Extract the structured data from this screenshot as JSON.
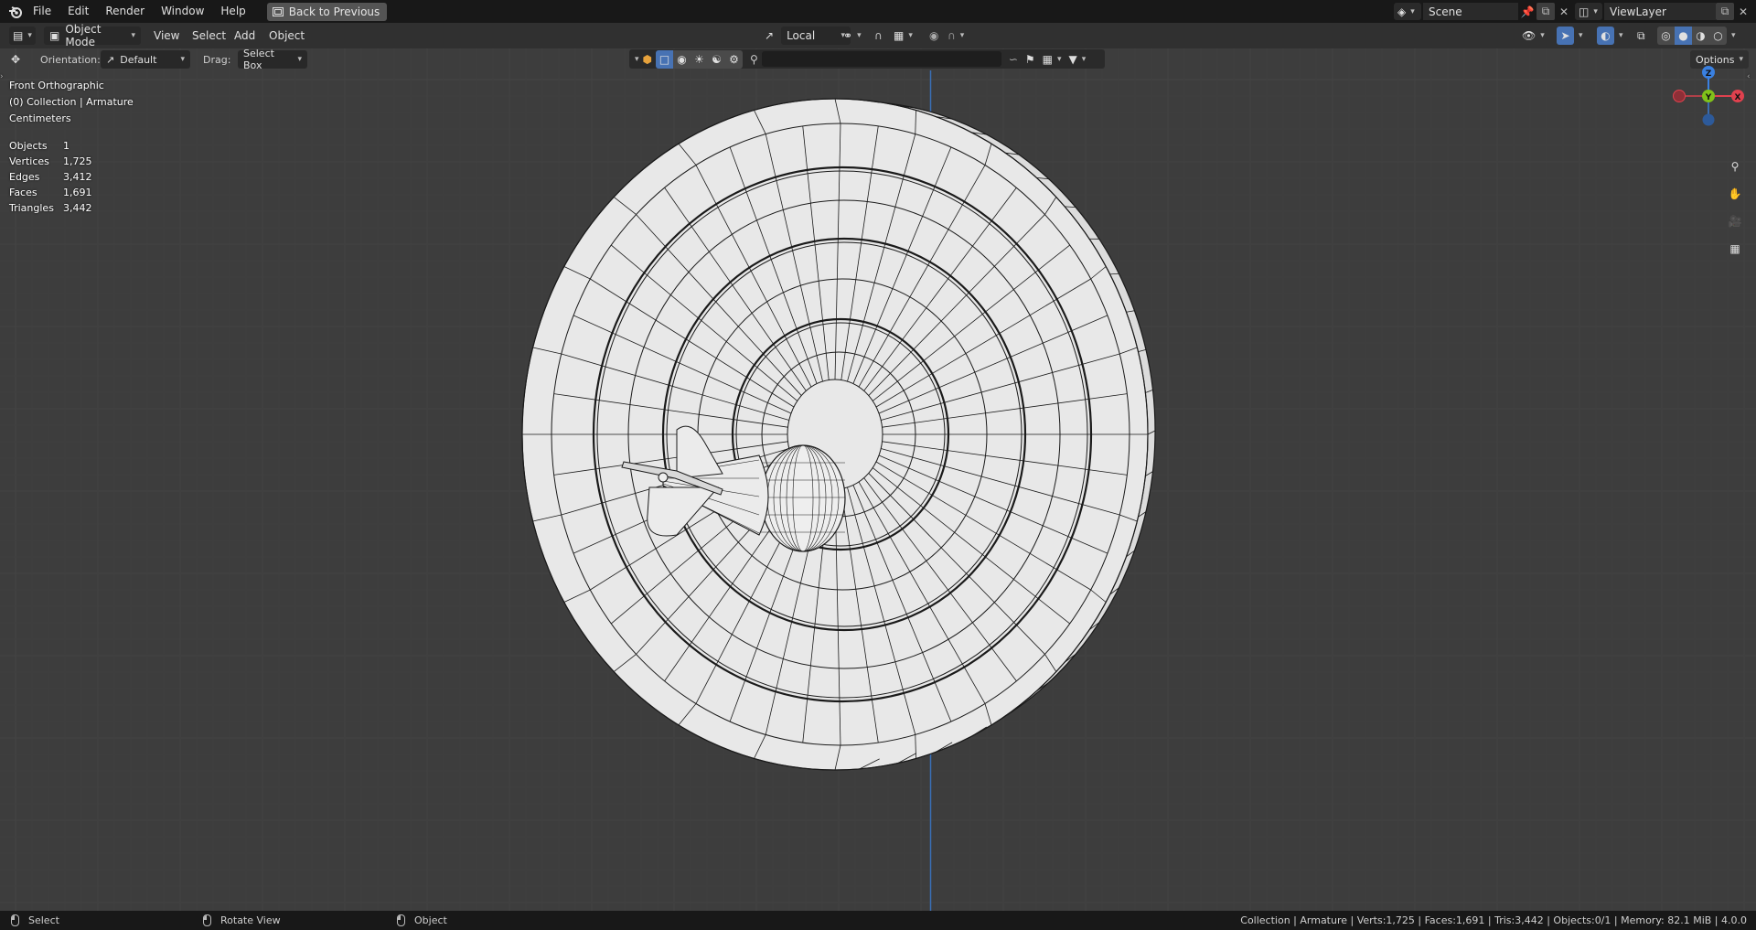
{
  "menu": {
    "items": [
      "File",
      "Edit",
      "Render",
      "Window",
      "Help"
    ],
    "back_button": "Back to Previous"
  },
  "scene": {
    "name": "Scene",
    "view_layer": "ViewLayer"
  },
  "header": {
    "mode": "Object Mode",
    "menus": [
      "View",
      "Select",
      "Add",
      "Object"
    ],
    "transform_orientation": "Local"
  },
  "toolsettings": {
    "orientation_label": "Orientation:",
    "orientation_value": "Default",
    "drag_label": "Drag:",
    "drag_value": "Select Box",
    "options_label": "Options"
  },
  "viewport_info": {
    "view_name": "Front Orthographic",
    "collection": "(0) Collection | Armature",
    "units": "Centimeters",
    "stats": [
      {
        "label": "Objects",
        "value": "1"
      },
      {
        "label": "Vertices",
        "value": "1,725"
      },
      {
        "label": "Edges",
        "value": "3,412"
      },
      {
        "label": "Faces",
        "value": "1,691"
      },
      {
        "label": "Triangles",
        "value": "3,442"
      }
    ]
  },
  "gizmo": {
    "z": "Z",
    "y": "Y",
    "x": "X"
  },
  "statusbar": {
    "hint_select": "Select",
    "hint_rotate": "Rotate View",
    "hint_object": "Object",
    "info": "Collection | Armature | Verts:1,725 | Faces:1,691 | Tris:3,442 | Objects:0/1 | Memory: 82.1 MiB | 4.0.0"
  },
  "colors": {
    "accent": "#4772b3",
    "axis_x": "#e0414e",
    "axis_y": "#80c11a",
    "axis_z": "#3a80e0",
    "mesh_face": "#e8e8e8",
    "mesh_wire": "#1a1a1a"
  }
}
